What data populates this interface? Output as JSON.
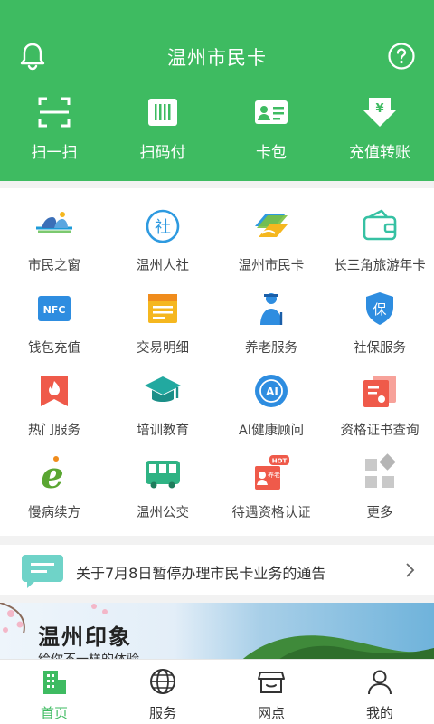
{
  "header": {
    "title": "温州市民卡",
    "icons": {
      "left": "bell-icon",
      "right": "help-icon"
    },
    "colors": {
      "primary": "#3ebb61"
    }
  },
  "quick_actions": [
    {
      "label": "扫一扫",
      "icon": "scan-icon"
    },
    {
      "label": "扫码付",
      "icon": "barcode-pay-icon"
    },
    {
      "label": "卡包",
      "icon": "card-wallet-icon"
    },
    {
      "label": "充值转账",
      "icon": "recharge-transfer-icon"
    }
  ],
  "services": [
    {
      "label": "市民之窗",
      "icon": "citizen-window-icon"
    },
    {
      "label": "温州人社",
      "icon": "social-security-bureau-icon",
      "glyph": "社"
    },
    {
      "label": "温州市民卡",
      "icon": "citizen-card-icon"
    },
    {
      "label": "长三角旅游年卡",
      "icon": "travel-card-icon"
    },
    {
      "label": "钱包充值",
      "icon": "nfc-wallet-icon",
      "glyph": "NFC"
    },
    {
      "label": "交易明细",
      "icon": "transaction-detail-icon"
    },
    {
      "label": "养老服务",
      "icon": "elderly-service-icon"
    },
    {
      "label": "社保服务",
      "icon": "insurance-service-icon",
      "glyph": "保"
    },
    {
      "label": "热门服务",
      "icon": "hot-service-icon"
    },
    {
      "label": "培训教育",
      "icon": "education-icon"
    },
    {
      "label": "AI健康顾问",
      "icon": "ai-health-icon",
      "glyph": "AI"
    },
    {
      "label": "资格证书查询",
      "icon": "certificate-icon"
    },
    {
      "label": "慢病续方",
      "icon": "chronic-prescription-icon",
      "glyph": "e"
    },
    {
      "label": "温州公交",
      "icon": "bus-icon"
    },
    {
      "label": "待遇资格认证",
      "icon": "pension-auth-icon",
      "glyph": "养老",
      "badge": "HOT"
    },
    {
      "label": "更多",
      "icon": "more-icon"
    }
  ],
  "notice": {
    "text": "关于7月8日暂停办理市民卡业务的通告"
  },
  "banner": {
    "title": "温州印象",
    "subtitle": "给你不一样的体验"
  },
  "tabbar": [
    {
      "label": "首页",
      "icon": "home-building-icon",
      "active": true
    },
    {
      "label": "服务",
      "icon": "globe-icon",
      "active": false
    },
    {
      "label": "网点",
      "icon": "store-icon",
      "active": false
    },
    {
      "label": "我的",
      "icon": "user-icon",
      "active": false
    }
  ]
}
